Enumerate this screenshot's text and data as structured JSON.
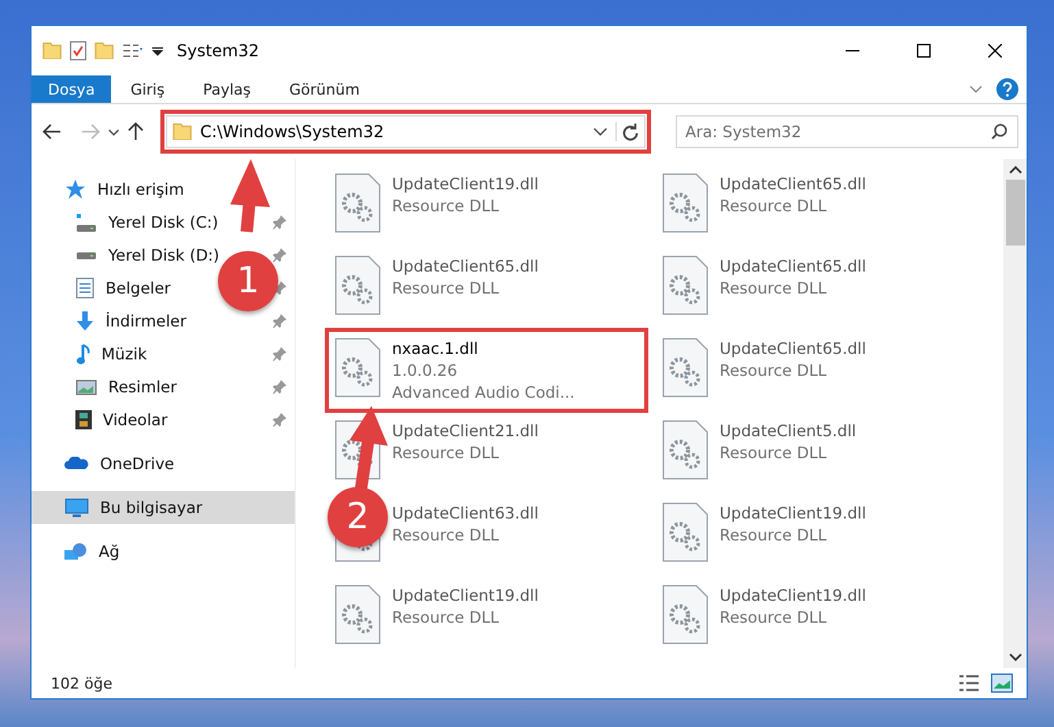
{
  "window": {
    "title": "System32"
  },
  "ribbon_tabs": [
    {
      "label": "Dosya",
      "kind": "file_menu"
    },
    {
      "label": "Giriş",
      "kind": "tab"
    },
    {
      "label": "Paylaş",
      "kind": "tab"
    },
    {
      "label": "Görünüm",
      "kind": "tab"
    }
  ],
  "address": {
    "value": "C:\\Windows\\System32",
    "highlighted": true
  },
  "search": {
    "placeholder": "Ara: System32"
  },
  "sidebar": [
    {
      "label": "Hızlı erişim",
      "selected": false,
      "children": [
        {
          "label": "Yerel Disk (C:)",
          "pinned": true,
          "selected": false
        },
        {
          "label": "Yerel Disk (D:)",
          "pinned": true,
          "selected": false
        },
        {
          "label": "Belgeler",
          "pinned": true,
          "selected": false
        },
        {
          "label": "İndirmeler",
          "pinned": true,
          "selected": false
        },
        {
          "label": "Müzik",
          "pinned": true,
          "selected": false
        },
        {
          "label": "Resimler",
          "pinned": true,
          "selected": false
        },
        {
          "label": "Videolar",
          "pinned": true,
          "selected": false
        }
      ]
    },
    {
      "label": "OneDrive",
      "selected": false
    },
    {
      "label": "Bu bilgisayar",
      "selected": true
    },
    {
      "label": "Ağ",
      "selected": false
    }
  ],
  "files": [
    {
      "name": "UpdateClient19.dll",
      "details": [
        "Resource DLL"
      ],
      "highlighted": false
    },
    {
      "name": "UpdateClient65.dll",
      "details": [
        "Resource DLL"
      ],
      "highlighted": false
    },
    {
      "name": "UpdateClient65.dll",
      "details": [
        "Resource DLL"
      ],
      "highlighted": false
    },
    {
      "name": "UpdateClient65.dll",
      "details": [
        "Resource DLL"
      ],
      "highlighted": false
    },
    {
      "name": "nxaac.1.dll",
      "details": [
        "1.0.0.26",
        "Advanced Audio Codi..."
      ],
      "highlighted": true
    },
    {
      "name": "UpdateClient65.dll",
      "details": [
        "Resource DLL"
      ],
      "highlighted": false
    },
    {
      "name": "UpdateClient21.dll",
      "details": [
        "Resource DLL"
      ],
      "highlighted": false
    },
    {
      "name": "UpdateClient5.dll",
      "details": [
        "Resource DLL"
      ],
      "highlighted": false
    },
    {
      "name": "UpdateClient63.dll",
      "details": [
        "Resource DLL"
      ],
      "highlighted": false
    },
    {
      "name": "UpdateClient19.dll",
      "details": [
        "Resource DLL"
      ],
      "highlighted": false
    },
    {
      "name": "UpdateClient19.dll",
      "details": [
        "Resource DLL"
      ],
      "highlighted": false
    },
    {
      "name": "UpdateClient19.dll",
      "details": [
        "Resource DLL"
      ],
      "highlighted": false
    }
  ],
  "annotations": [
    {
      "number": "1"
    },
    {
      "number": "2"
    }
  ],
  "status_bar": {
    "count": "102 öğe"
  }
}
